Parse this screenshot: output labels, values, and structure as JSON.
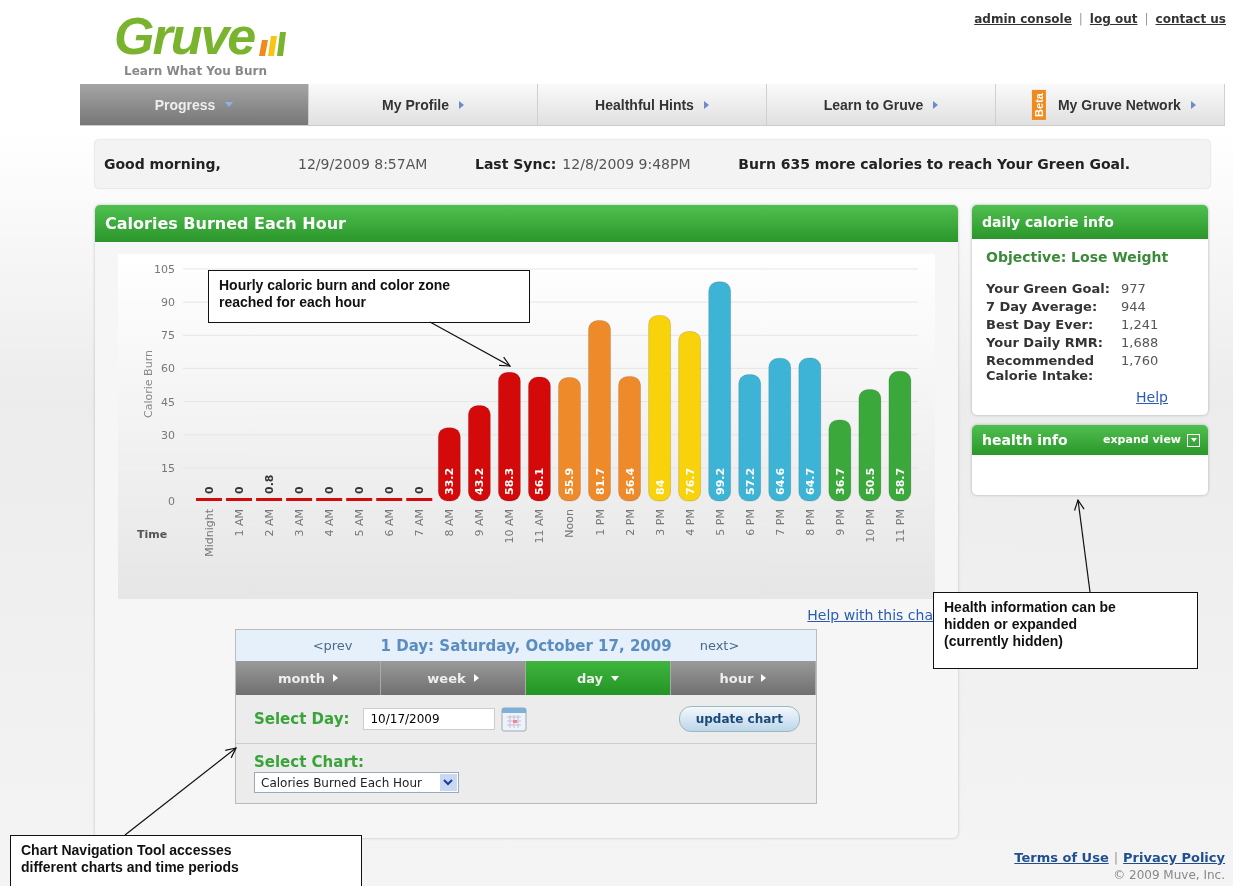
{
  "logo": {
    "name": "Gruve",
    "tagline": "Learn What You Burn"
  },
  "header_links": [
    {
      "kind": "link",
      "text": "admin console"
    },
    {
      "kind": "separator",
      "text": "|"
    },
    {
      "kind": "link",
      "text": "log out"
    },
    {
      "kind": "separator",
      "text": "|"
    },
    {
      "kind": "link",
      "text": "contact us"
    }
  ],
  "nav": [
    {
      "label": "Progress",
      "selected": true
    },
    {
      "label": "My Profile",
      "selected": false
    },
    {
      "label": "Healthful Hints",
      "selected": false
    },
    {
      "label": "Learn to Gruve",
      "selected": false
    },
    {
      "label": "My Gruve Network",
      "selected": false,
      "badge": "Beta"
    }
  ],
  "greeting": {
    "salutation": "Good morning,",
    "date": "12/9/2009 8:57AM",
    "sync_label": "Last Sync:",
    "sync_date": "12/8/2009 9:48PM",
    "goal_message": "Burn 635 more calories to reach Your Green Goal."
  },
  "chart_panel": {
    "title": "Calories Burned Each Hour",
    "help_link": "Help with this cha",
    "chart_data": {
      "type": "bar",
      "xlabel": "Time",
      "ylabel": "Calorie Burn",
      "ylim": [
        0,
        105
      ],
      "yticks": [
        0,
        15,
        30,
        45,
        60,
        75,
        90,
        105
      ],
      "data_labels": true,
      "grid": true,
      "categories": [
        "Midnight",
        "1 AM",
        "2 AM",
        "3 AM",
        "4 AM",
        "5 AM",
        "6 AM",
        "7 AM",
        "8 AM",
        "9 AM",
        "10 AM",
        "11 AM",
        "Noon",
        "1 PM",
        "2 PM",
        "3 PM",
        "4 PM",
        "5 PM",
        "6 PM",
        "7 PM",
        "8 PM",
        "9 PM",
        "10 PM",
        "11 PM"
      ],
      "series": [
        {
          "color": "#d40a0a",
          "values": [
            0,
            0,
            0.8,
            0,
            0,
            0,
            0,
            0,
            33.2,
            43.2,
            58.3,
            56.1,
            null,
            null,
            null,
            null,
            null,
            null,
            null,
            null,
            null,
            null,
            null,
            null
          ]
        },
        {
          "color": "#ee8a2a",
          "values": [
            null,
            null,
            null,
            null,
            null,
            null,
            null,
            null,
            null,
            null,
            null,
            null,
            55.9,
            81.7,
            56.4,
            null,
            null,
            null,
            null,
            null,
            null,
            null,
            null,
            null
          ]
        },
        {
          "color": "#f8d20a",
          "values": [
            null,
            null,
            null,
            null,
            null,
            null,
            null,
            null,
            null,
            null,
            null,
            null,
            null,
            null,
            null,
            84,
            76.7,
            null,
            null,
            null,
            null,
            null,
            null,
            null
          ]
        },
        {
          "color": "#3db4d6",
          "values": [
            null,
            null,
            null,
            null,
            null,
            null,
            null,
            null,
            null,
            null,
            null,
            null,
            null,
            null,
            null,
            null,
            null,
            99.2,
            57.2,
            64.6,
            64.7,
            null,
            null,
            null
          ]
        },
        {
          "color": "#3aa83a",
          "values": [
            null,
            null,
            null,
            null,
            null,
            null,
            null,
            null,
            null,
            null,
            null,
            null,
            null,
            null,
            null,
            null,
            null,
            null,
            null,
            null,
            null,
            36.7,
            50.5,
            58.7
          ]
        }
      ]
    }
  },
  "chart_nav": {
    "prev": "<prev",
    "period": "1 Day: Saturday, October 17, 2009",
    "next": "next>",
    "tabs": [
      {
        "label": "month",
        "selected": false
      },
      {
        "label": "week",
        "selected": false
      },
      {
        "label": "day",
        "selected": true
      },
      {
        "label": "hour",
        "selected": false
      }
    ],
    "day_label": "Select Day:",
    "day_value": "10/17/2009",
    "update_button": "update chart",
    "chart_label": "Select Chart:",
    "chart_value": "Calories Burned Each Hour"
  },
  "daily_calorie_info": {
    "title": "daily calorie info",
    "objective": "Objective: Lose Weight",
    "rows": [
      {
        "label": "Your Green Goal:",
        "value": "977"
      },
      {
        "label": "7 Day Average:",
        "value": "944"
      },
      {
        "label": "Best Day Ever:",
        "value": "1,241"
      },
      {
        "label": "Your Daily RMR:",
        "value": "1,688"
      },
      {
        "label": "Recommended Calorie Intake:",
        "value": "1,760"
      }
    ],
    "help_link": "Help"
  },
  "health_info": {
    "title": "health info",
    "toggle": "expand view",
    "expanded": false
  },
  "footer": {
    "links": [
      {
        "kind": "link",
        "text": "Terms of Use"
      },
      {
        "kind": "separator",
        "text": "|"
      },
      {
        "kind": "link",
        "text": "Privacy Policy"
      }
    ],
    "copyright": "© 2009 Muve, Inc."
  },
  "callouts": [
    {
      "text": "Hourly caloric burn and color zone reached for each hour"
    },
    {
      "text": "Health information can be hidden or expanded (currently hidden)"
    },
    {
      "text": "Chart Navigation Tool accesses different charts and time periods"
    }
  ]
}
